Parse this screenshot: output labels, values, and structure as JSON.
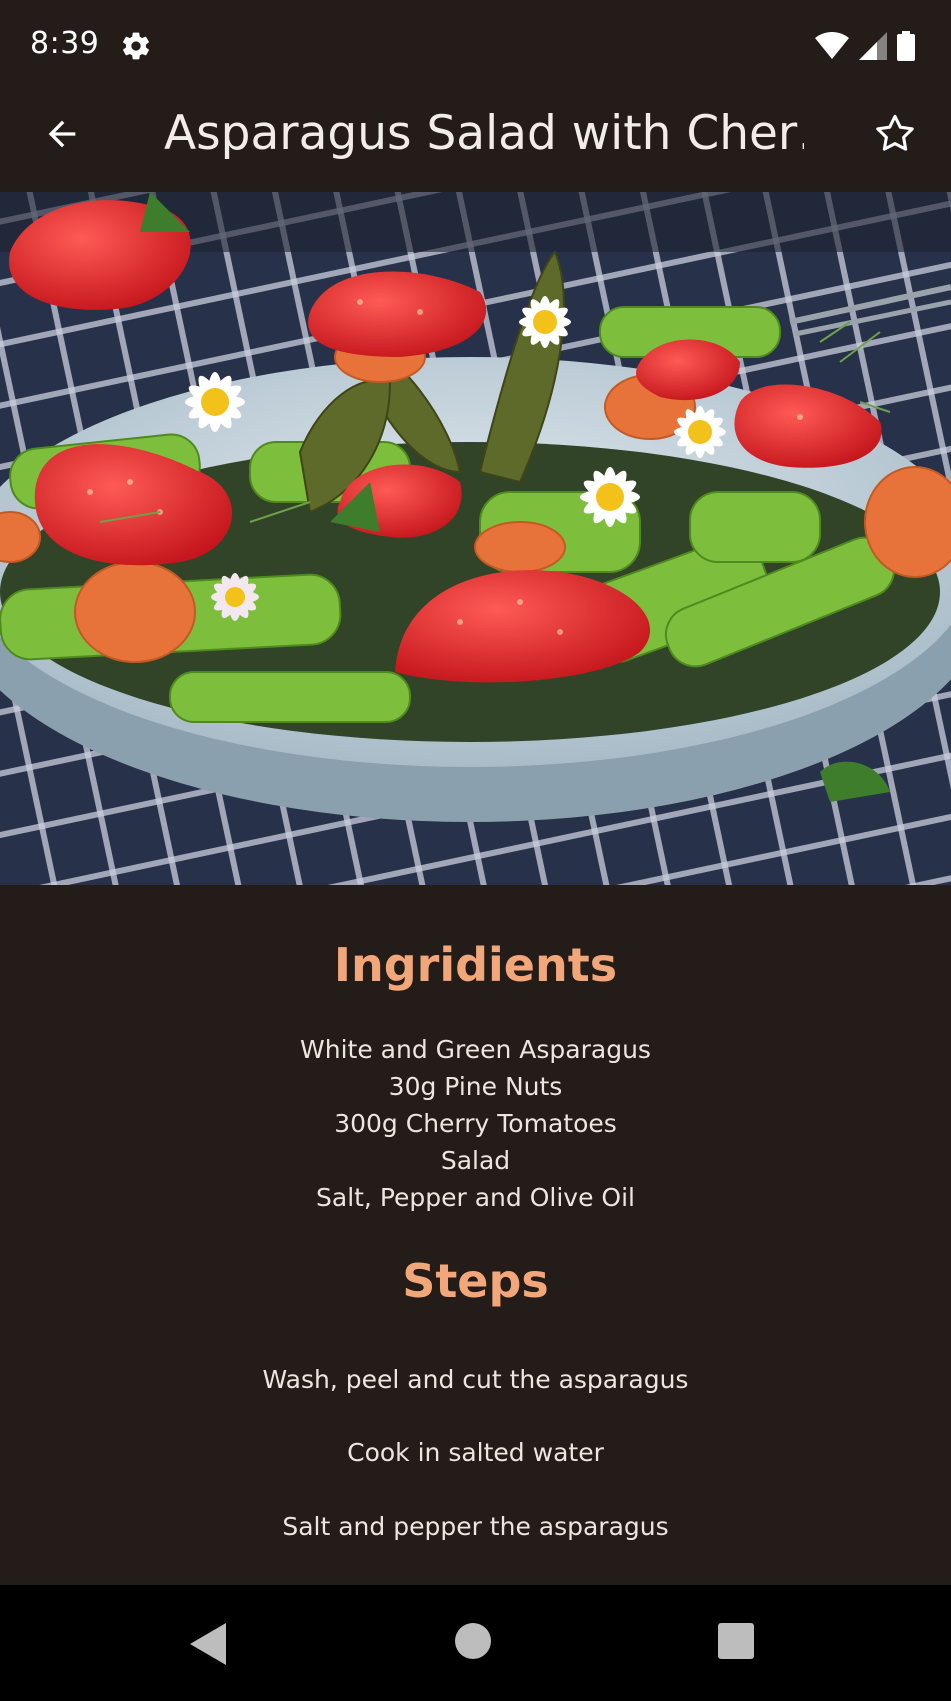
{
  "status_bar": {
    "time": "8:39",
    "icons": [
      "gear-icon",
      "wifi-icon",
      "signal-icon",
      "battery-icon"
    ]
  },
  "app_bar": {
    "title": "Asparagus Salad with Cher…",
    "back_icon": "arrow-left-icon",
    "favorite_icon": "star-outline-icon"
  },
  "hero_image": {
    "subject": "salad bowl"
  },
  "ingredients": {
    "title": "Ingridients",
    "items": [
      "White and Green Asparagus",
      "30g Pine Nuts",
      "300g Cherry Tomatoes",
      "Salad",
      "Salt, Pepper and Olive Oil"
    ]
  },
  "steps": {
    "title": "Steps",
    "items": [
      "Wash, peel and cut the asparagus",
      "Cook in salted water",
      "Salt and pepper the asparagus"
    ]
  },
  "nav_bar": {
    "icons": [
      "nav-back-icon",
      "nav-home-icon",
      "nav-recents-icon"
    ]
  },
  "colors": {
    "background": "#231c18",
    "accent": "#f2a77b",
    "text": "#ece6e0",
    "nav_bar": "#000000"
  }
}
